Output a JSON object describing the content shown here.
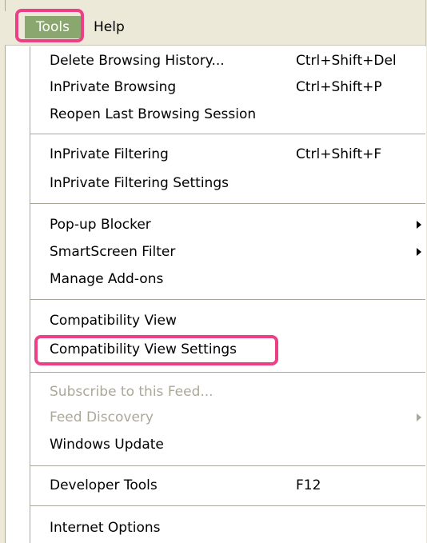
{
  "menubar": {
    "tools_label": "Tools",
    "help_label": "Help"
  },
  "menu": {
    "items": [
      {
        "label": "Delete Browsing History...",
        "shortcut": "Ctrl+Shift+Del"
      },
      {
        "label": "InPrivate Browsing",
        "shortcut": "Ctrl+Shift+P"
      },
      {
        "label": "Reopen Last Browsing Session"
      },
      {
        "label": "InPrivate Filtering",
        "shortcut": "Ctrl+Shift+F"
      },
      {
        "label": "InPrivate Filtering Settings"
      },
      {
        "label": "Pop-up Blocker",
        "submenu": true
      },
      {
        "label": "SmartScreen Filter",
        "submenu": true
      },
      {
        "label": "Manage Add-ons"
      },
      {
        "label": "Compatibility View"
      },
      {
        "label": "Compatibility View Settings",
        "highlighted": true
      },
      {
        "label": "Subscribe to this Feed...",
        "disabled": true
      },
      {
        "label": "Feed Discovery",
        "disabled": true,
        "submenu": true
      },
      {
        "label": "Windows Update"
      },
      {
        "label": "Developer Tools",
        "shortcut": "F12"
      },
      {
        "label": "Internet Options"
      }
    ]
  },
  "colors": {
    "highlight_border": "#ed3f86",
    "tools_active_bg": "#8aa770",
    "disabled_text": "#aca899"
  }
}
